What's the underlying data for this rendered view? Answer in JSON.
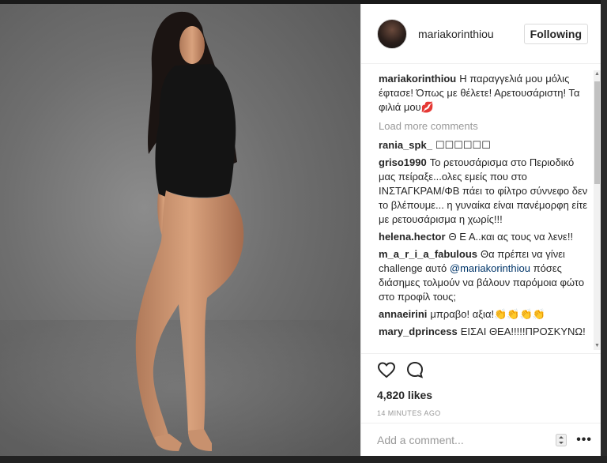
{
  "post": {
    "username": "mariakorinthiou",
    "follow_label": "Following",
    "caption_author": "mariakorinthiou",
    "caption_text": "Η παραγγελιά μου μόλις έφτασε! Όπως με θέλετε! Αρετουσάριστη! Τα φιλιά μου💋",
    "load_more": "Load more comments",
    "likes": "4,820 likes",
    "time": "14 MINUTES AGO",
    "add_comment_placeholder": "Add a comment..."
  },
  "comments": [
    {
      "author": "rania_spk_",
      "text": "☐☐☐☐☐☐"
    },
    {
      "author": "griso1990",
      "text": "Το ρετουσάρισμα στο Περιοδικό μας πείραξε...ολες εμείς που στο ΙΝΣΤΑΓΚΡΑΜ/ΦΒ πάει το φίλτρο σύννεφο δεν το βλέπουμε... η γυναίκα είναι πανέμορφη είτε με ρετουσάρισμα η χωρίς!!!"
    },
    {
      "author": "helena.hector",
      "text": "Θ Ε Α..και ας τους να λενε!!"
    },
    {
      "author": "m_a_r_i_a_fabulous",
      "text_before": "Θα πρέπει να γίνει challenge αυτό",
      "mention": "@mariakorinthiou",
      "text_after": "πόσες διάσημες τολμούν να βάλουν παρόμοια φώτο στο προφίλ τους;"
    },
    {
      "author": "annaeirini",
      "text": "μπραβο! αξια!👏👏👏👏"
    },
    {
      "author": "mary_dprincess",
      "text": "ΕΙΣΑΙ ΘΕΑ!!!!!ΠΡΟΣΚΥΝΩ!"
    }
  ],
  "icons": {
    "like": "heart-icon",
    "comment": "comment-icon",
    "stepper": "stepper-icon",
    "more": "more-icon"
  },
  "colors": {
    "text": "#262626",
    "muted": "#999999",
    "mention": "#003569",
    "border": "#dbdbdb"
  }
}
